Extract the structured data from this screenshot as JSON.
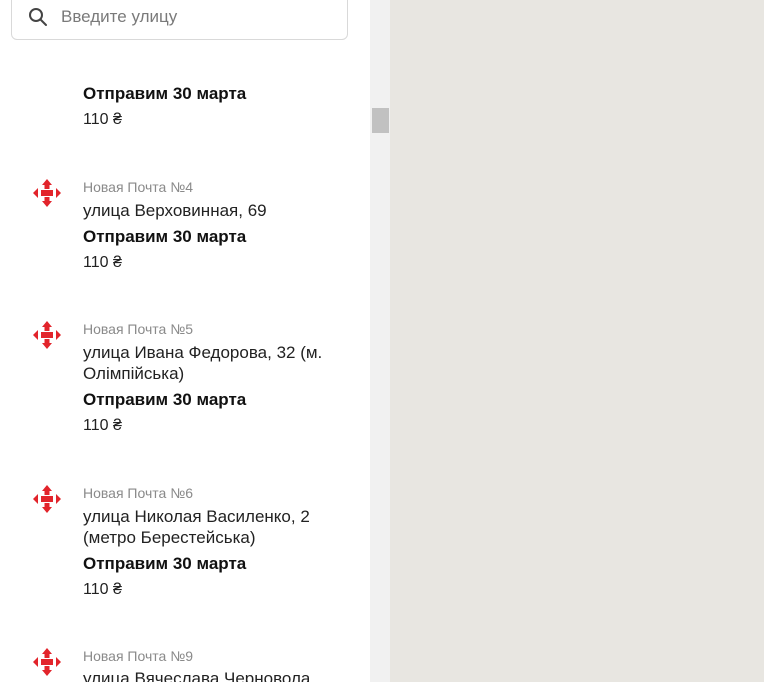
{
  "search": {
    "placeholder": "Введите улицу",
    "value": ""
  },
  "items": [
    {
      "branch": "",
      "address": "",
      "send_date": "Отправим 30 марта",
      "price": "110 ₴"
    },
    {
      "branch": "Новая Почта №4",
      "address": "улица Верховинная, 69",
      "send_date": "Отправим 30 марта",
      "price": "110 ₴"
    },
    {
      "branch": "Новая Почта №5",
      "address": "улица Ивана Федорова, 32 (м. Олімпійська)",
      "send_date": "Отправим 30 марта",
      "price": "110 ₴"
    },
    {
      "branch": "Новая Почта №6",
      "address": "улица Николая Василенко, 2 (метро Берестейська)",
      "send_date": "Отправим 30 марта",
      "price": "110 ₴"
    },
    {
      "branch": "Новая Почта №9",
      "address": "улица Вячеслава Черновола",
      "send_date": "",
      "price": ""
    }
  ],
  "colors": {
    "brand": "#e2242b",
    "map_bg": "#e8e6e1"
  },
  "icons": {
    "search": "search-icon",
    "logo": "nova-poshta-logo-icon"
  }
}
